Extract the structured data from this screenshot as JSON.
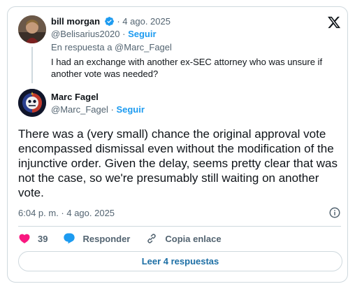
{
  "parent_tweet": {
    "author_name": "bill morgan",
    "date": "4 ago. 2025",
    "handle": "@Belisarius2020",
    "separator": "·",
    "follow_label": "Seguir",
    "reply_to": "En respuesta a @Marc_Fagel",
    "text": "I had an exchange with another ex-SEC attorney who was unsure if another vote was needed?"
  },
  "main_tweet": {
    "author_name": "Marc Fagel",
    "handle": "@Marc_Fagel",
    "separator": "·",
    "follow_label": "Seguir",
    "text": "There was a (very small) chance the original approval vote encompassed dismissal even without the modification of the injunctive order. Given the delay, seems pretty clear that was not the case, so we're presumably still waiting on another vote.",
    "timestamp": "6:04 p. m. · 4 ago. 2025"
  },
  "actions": {
    "likes": "39",
    "reply_label": "Responder",
    "copy_link_label": "Copia enlace"
  },
  "read_replies_label": "Leer 4 respuestas",
  "colors": {
    "accent": "#1d9bf0",
    "like": "#f91880",
    "border": "#cfd9de",
    "muted_text": "#536471"
  },
  "icons": [
    "x-logo-icon",
    "verified-badge-icon",
    "info-icon",
    "heart-icon",
    "reply-bubble-icon",
    "link-icon"
  ]
}
